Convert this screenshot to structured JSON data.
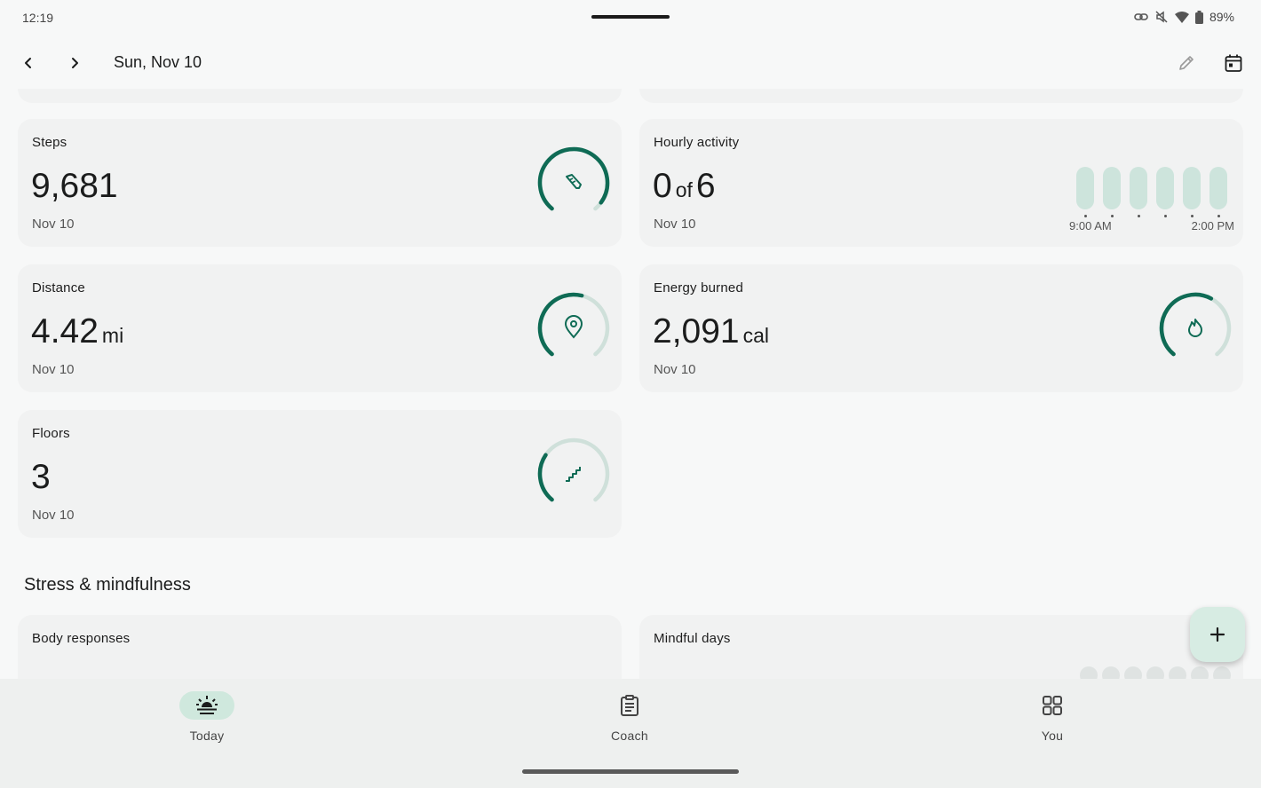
{
  "status_bar": {
    "time": "12:19",
    "battery": "89%",
    "icons": [
      "link-icon",
      "mute-icon",
      "wifi-icon",
      "battery-icon"
    ]
  },
  "app_bar": {
    "date": "Sun, Nov 10",
    "icons": [
      "chevron-left-icon",
      "chevron-right-icon",
      "pencil-icon",
      "calendar-icon"
    ]
  },
  "cards": {
    "steps": {
      "title": "Steps",
      "value": "9,681",
      "date": "Nov 10",
      "progress": 0.95,
      "icon": "shoe-icon"
    },
    "hourly": {
      "title": "Hourly activity",
      "value": "0",
      "of": "of",
      "goal": "6",
      "date": "Nov 10",
      "bars": [
        0,
        0,
        0,
        0,
        0,
        0
      ],
      "start_label": "9:00 AM",
      "end_label": "2:00 PM"
    },
    "distance": {
      "title": "Distance",
      "value": "4.42",
      "unit": "mi",
      "date": "Nov 10",
      "progress": 0.55,
      "icon": "location-pin-icon"
    },
    "energy": {
      "title": "Energy burned",
      "value": "2,091",
      "unit": "cal",
      "date": "Nov 10",
      "progress": 0.6,
      "icon": "flame-icon"
    },
    "floors": {
      "title": "Floors",
      "value": "3",
      "date": "Nov 10",
      "progress": 0.3,
      "icon": "stairs-icon"
    }
  },
  "section": {
    "title": "Stress & mindfulness"
  },
  "stress_cards": {
    "body_responses": {
      "title": "Body responses"
    },
    "mindful_days": {
      "title": "Mindful days"
    }
  },
  "fab": {
    "icon": "plus-icon"
  },
  "bottom_nav": {
    "items": [
      {
        "label": "Today",
        "icon": "sunrise-icon",
        "active": true
      },
      {
        "label": "Coach",
        "icon": "clipboard-icon",
        "active": false
      },
      {
        "label": "You",
        "icon": "grid-icon",
        "active": false
      }
    ]
  },
  "colors": {
    "accent": "#0f6b55",
    "track": "#cfe0da",
    "card": "#f1f2f2",
    "nav_active": "#cfe8dd"
  }
}
